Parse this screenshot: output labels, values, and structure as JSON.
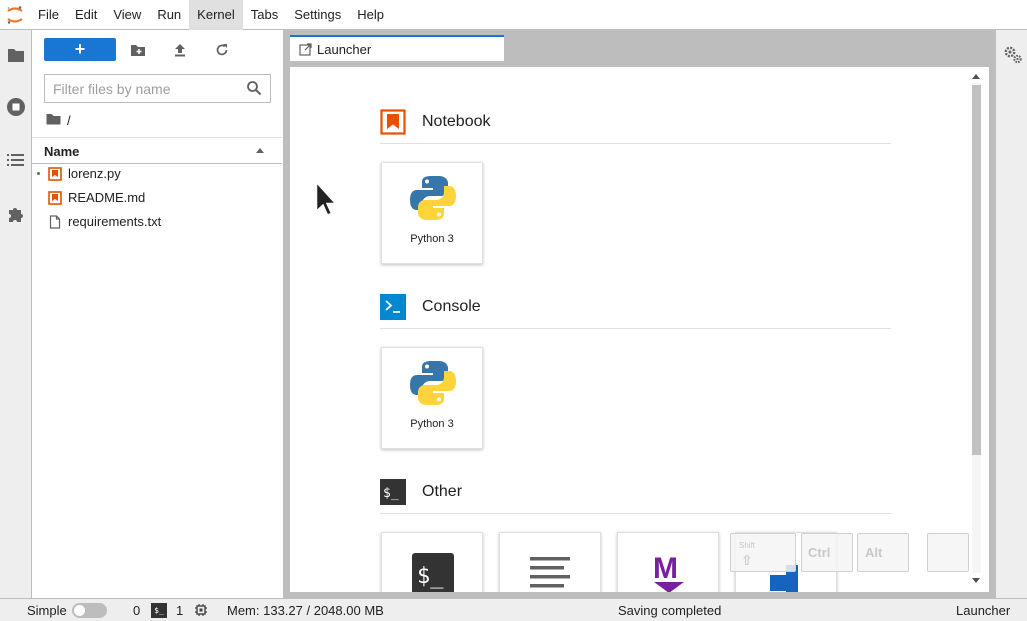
{
  "menubar": {
    "items": [
      "File",
      "Edit",
      "View",
      "Run",
      "Kernel",
      "Tabs",
      "Settings",
      "Help"
    ],
    "active": "Kernel"
  },
  "filebrowser": {
    "filter_placeholder": "Filter files by name",
    "breadcrumb": "/",
    "column_name": "Name",
    "files": [
      {
        "name": "lorenz.py",
        "icon": "python-file-icon",
        "running": true
      },
      {
        "name": "README.md",
        "icon": "markdown-file-icon",
        "running": false
      },
      {
        "name": "requirements.txt",
        "icon": "text-file-icon",
        "running": false
      }
    ]
  },
  "tabs": [
    {
      "label": "Launcher",
      "active": true
    }
  ],
  "launcher": {
    "sections": [
      {
        "title": "Notebook",
        "icon": "notebook-icon",
        "cards": [
          {
            "label": "Python 3",
            "icon": "python-logo-icon"
          }
        ]
      },
      {
        "title": "Console",
        "icon": "console-icon",
        "cards": [
          {
            "label": "Python 3",
            "icon": "python-logo-icon"
          }
        ]
      },
      {
        "title": "Other",
        "icon": "other-terminal-icon",
        "cards": [
          {
            "label": "",
            "icon": "terminal-icon"
          },
          {
            "label": "",
            "icon": "text-file-icon"
          },
          {
            "label": "",
            "icon": "markdown-icon"
          },
          {
            "label": "",
            "icon": "contextual-help-icon"
          }
        ]
      }
    ]
  },
  "keyboard_overlay": {
    "keys": [
      "Shift",
      "Ctrl",
      "Alt",
      ""
    ]
  },
  "statusbar": {
    "mode_label": "Simple",
    "terminals_count": "0",
    "kernels_count": "1",
    "memory": "Mem: 133.27 / 2048.00 MB",
    "message": "Saving completed",
    "active_tab": "Launcher"
  },
  "colors": {
    "accent": "#1976d2",
    "notebook_orange": "#e65100",
    "console_blue": "#0288d1",
    "markdown_purple": "#7b1fa2"
  }
}
